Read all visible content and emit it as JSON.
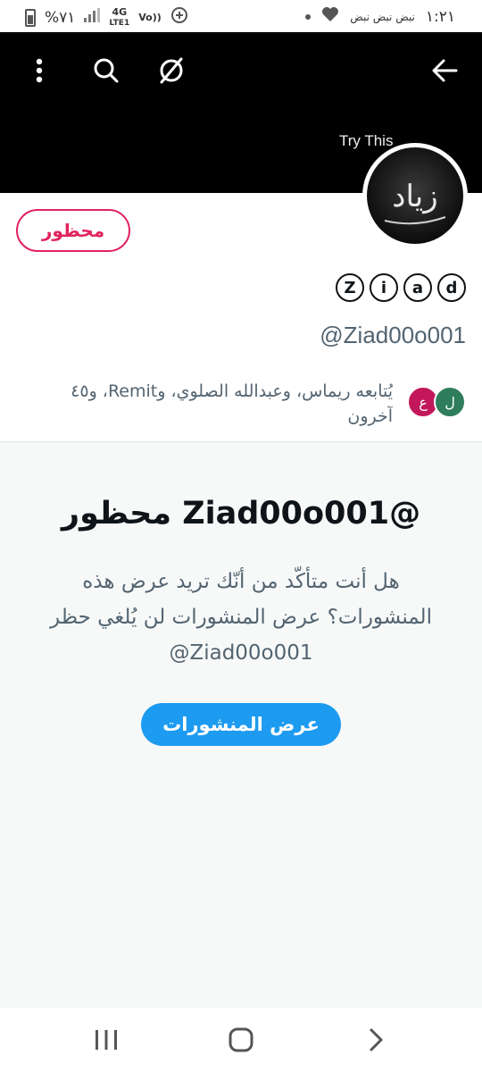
{
  "status_bar": {
    "time": "١:٢١",
    "notifications": "نبض نبض نبض",
    "battery": "%٧١",
    "network_top": "4G",
    "network_bottom": "LTE1",
    "volte_top": "Vo))",
    "icons": [
      "battery-icon",
      "signal-icon",
      "data-saver-icon",
      "heart-icon",
      "dot-icon"
    ]
  },
  "header": {
    "banner_text": "Try This",
    "icons": [
      "back-arrow-icon",
      "no-sync-icon",
      "search-icon",
      "more-vert-icon"
    ],
    "colors": {
      "banner_bg": "#000000"
    }
  },
  "profile": {
    "avatar_text": "زياد",
    "blocked_button_label": "محظور",
    "display_name_letters": [
      "Z",
      "i",
      "a",
      "d"
    ],
    "handle": "@Ziad00o001",
    "followers": {
      "avatars": [
        {
          "letter": "ل",
          "color": "#2e7d5b"
        },
        {
          "letter": "ع",
          "color": "#c2185b"
        }
      ],
      "line1": "يُتابعه ريماس، وعبدالله الصلوي، وRemit، و٤٥",
      "line2": "آخرون"
    }
  },
  "blocked_panel": {
    "title": "@Ziad00o001 محظور",
    "description": "هل أنت متأكّد من أنّك تريد عرض هذه المنشورات؟ عرض المنشورات لن يُلغي حظر Ziad00o001@",
    "view_button_label": "عرض المنشورات"
  },
  "navbar": {
    "icons": [
      "recent-apps-icon",
      "home-icon",
      "back-chevron-icon"
    ]
  },
  "colors": {
    "accent": "#1d9bf0",
    "danger": "#e0245e",
    "secondary_text": "#536471",
    "panel_bg": "#f7f9f9"
  }
}
